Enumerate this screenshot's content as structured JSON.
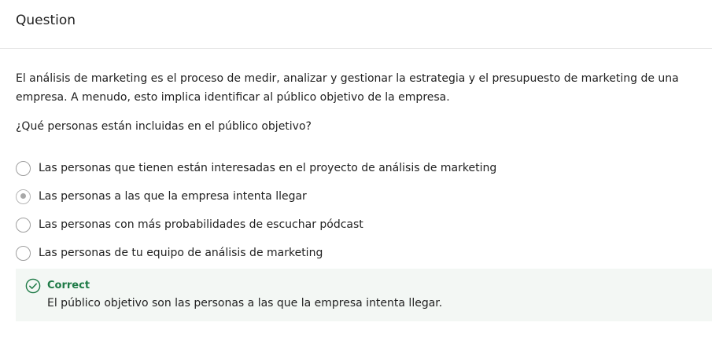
{
  "header": {
    "title": "Question"
  },
  "question": {
    "intro": "El análisis de marketing es el proceso de medir, analizar y gestionar la estrategia y el presupuesto de marketing de una empresa. A menudo, esto implica identificar al público objetivo de la empresa.",
    "prompt": "¿Qué personas están incluidas en el público objetivo?",
    "options": [
      {
        "label": "Las personas que tienen están interesadas en el proyecto de análisis de marketing",
        "selected": false
      },
      {
        "label": "Las personas a las que la empresa intenta llegar",
        "selected": true
      },
      {
        "label": "Las personas con más probabilidades de escuchar pódcast",
        "selected": false
      },
      {
        "label": "Las personas de tu equipo de análisis de marketing",
        "selected": false
      }
    ]
  },
  "feedback": {
    "status": "Correct",
    "icon": "check-circle-icon",
    "message": "El público objetivo son las personas a las que la empresa intenta llegar.",
    "color": "#1e7a46",
    "background": "#f3f7f4"
  }
}
